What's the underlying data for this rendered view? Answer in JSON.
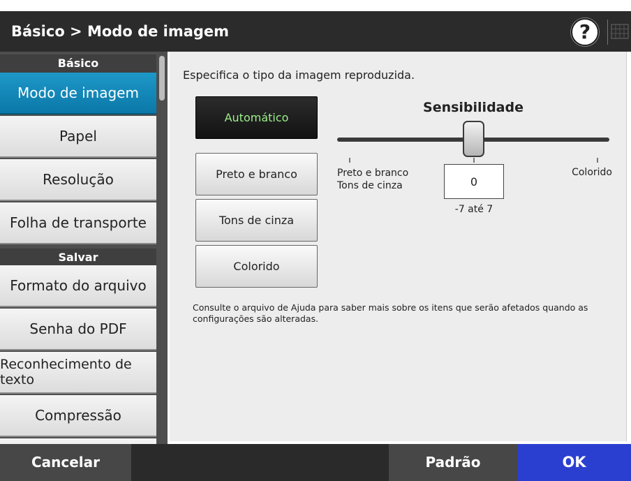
{
  "header": {
    "title": "Básico > Modo de imagem",
    "help_icon_glyph": "?",
    "icons": [
      "help-icon",
      "keyboard-icon"
    ]
  },
  "sidebar": {
    "sections": [
      {
        "label": "Básico"
      },
      {
        "label": "Salvar"
      }
    ],
    "items": [
      {
        "label": "Modo de imagem",
        "selected": true
      },
      {
        "label": "Papel"
      },
      {
        "label": "Resolução"
      },
      {
        "label": "Folha de transporte"
      },
      {
        "label": "Formato do arquivo"
      },
      {
        "label": "Senha do PDF"
      },
      {
        "label": "Reconhecimento de texto"
      },
      {
        "label": "Compressão"
      }
    ]
  },
  "main": {
    "description": "Especifica o tipo da imagem reproduzida.",
    "modes": [
      {
        "label": "Automático",
        "selected": true
      },
      {
        "label": "Preto e branco"
      },
      {
        "label": "Tons de cinza"
      },
      {
        "label": "Colorido"
      }
    ],
    "sensitivity": {
      "title": "Sensibilidade",
      "left_label_line1": "Preto e branco",
      "left_label_line2": "Tons de cinza",
      "right_label": "Colorido",
      "value": "0",
      "range": "-7 até 7"
    },
    "note": "Consulte o arquivo de Ajuda para saber mais sobre os itens que serão afetados quando as configurações são alteradas."
  },
  "footer": {
    "cancel": "Cancelar",
    "default": "Padrão",
    "ok": "OK"
  },
  "colors": {
    "selected_item": "#0b78a8",
    "ok_button": "#2a3fd0",
    "auto_text": "#9cf08a"
  }
}
